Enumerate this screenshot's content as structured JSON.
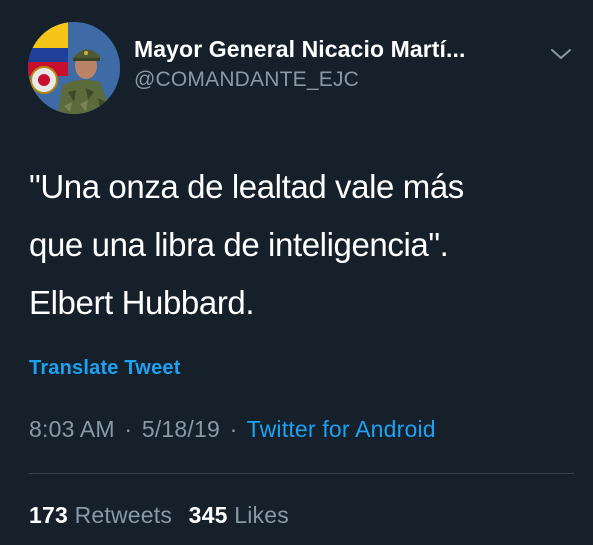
{
  "tweet": {
    "author": {
      "display_name": "Mayor General Nicacio Martí...",
      "handle": "@COMANDANTE_EJC",
      "avatar_icon": "avatar-soldier-flag"
    },
    "text_lines": [
      "\"Una onza de lealtad vale más",
      "que una libra de inteligencia\".",
      "Elbert Hubbard."
    ],
    "translate_label": "Translate Tweet",
    "time": "8:03 AM",
    "separator": "·",
    "date": "5/18/19",
    "source": "Twitter for Android",
    "retweets": {
      "count": "173",
      "label": "Retweets"
    },
    "likes": {
      "count": "345",
      "label": "Likes"
    }
  },
  "colors": {
    "background": "#15202b",
    "text": "#ffffff",
    "muted": "#8899a6",
    "accent": "#1da1f2",
    "divider": "#38444d"
  }
}
